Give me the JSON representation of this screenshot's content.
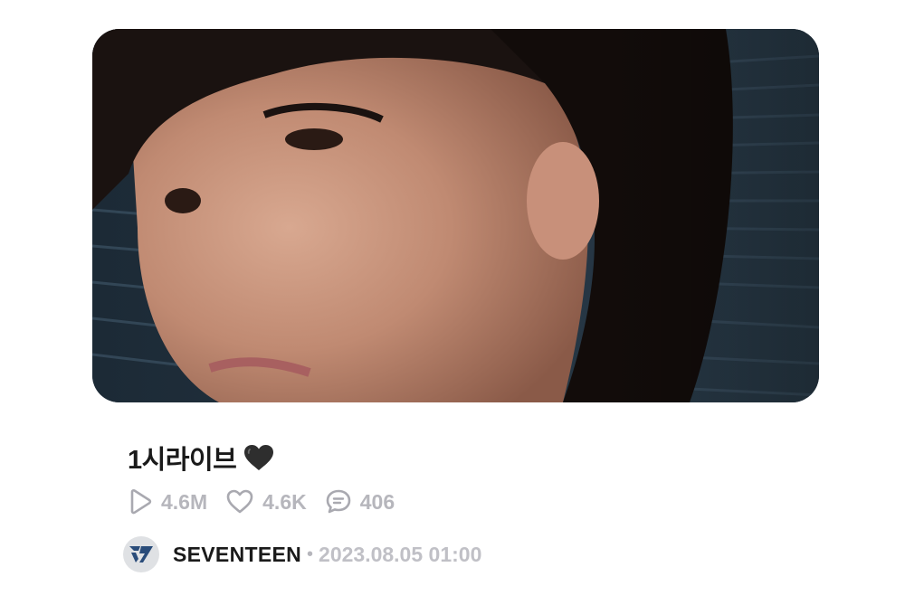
{
  "post": {
    "title": "1시라이브",
    "title_emoji": "black-heart",
    "stats": {
      "plays": "4.6M",
      "likes": "4.6K",
      "comments": "406"
    },
    "artist": "SEVENTEEN",
    "separator": "•",
    "date": "2023.08.05 01:00"
  },
  "colors": {
    "stat_gray": "#b6b6bc",
    "title_text": "#1a1a1a",
    "avatar_bg": "#dfe1e4",
    "logo_blue": "#2a4c7a"
  },
  "icons": [
    "play-icon",
    "heart-icon",
    "comment-icon",
    "black-heart-emoji",
    "seventeen-logo-icon"
  ]
}
